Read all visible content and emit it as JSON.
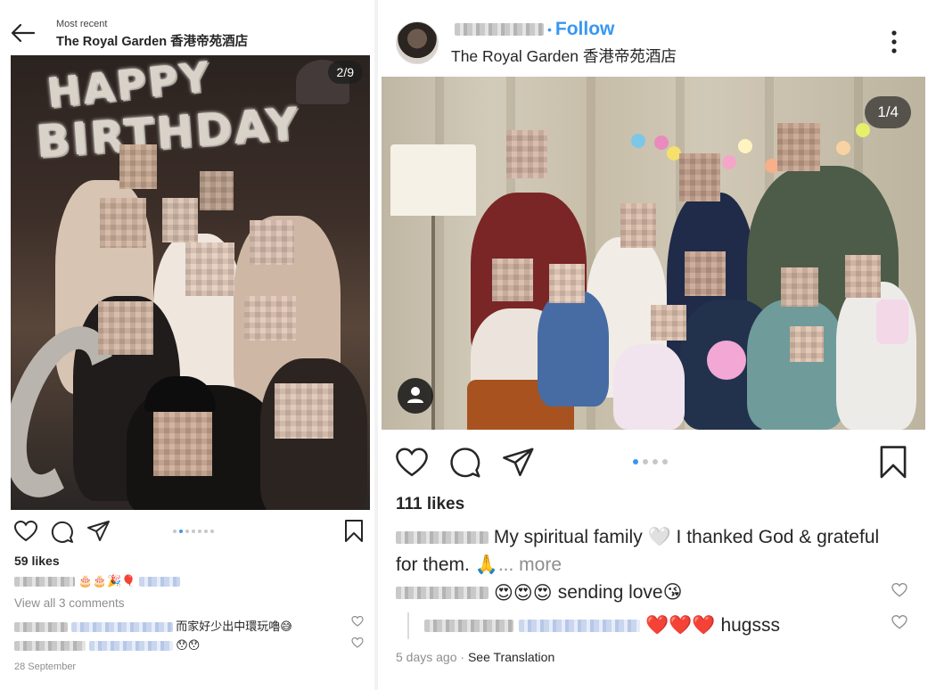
{
  "left_post": {
    "header": {
      "subtitle": "Most recent",
      "title": "The Royal Garden 香港帝苑酒店"
    },
    "photo": {
      "counter": "2/9",
      "balloon_line1": "HAPPY",
      "balloon_line2": "BIRTHDAY"
    },
    "likes": "59 likes",
    "caption_emojis": "🎂🎂🎉🎈",
    "view_all": "View all 3 comments",
    "comment1_text": "而家好少出中環玩嚕😅",
    "comment2_text": "😯😯",
    "date": "28 September"
  },
  "right_post": {
    "header": {
      "separator": "•",
      "follow": "Follow",
      "location": "The Royal Garden 香港帝苑酒店"
    },
    "photo": {
      "counter": "1/4"
    },
    "likes": "111 likes",
    "caption_text": "My spiritual family 🤍 I thanked God & grateful for them. 🙏",
    "caption_more": "... more",
    "comment1_emojis": "😍😍😍",
    "comment1_text": "sending love😘",
    "reply_emojis": "❤️❤️❤️",
    "reply_text": "hugsss",
    "time": "5 days ago",
    "separator": " · ",
    "see_translation": "See Translation"
  },
  "colors": {
    "accent": "#3897f0",
    "text": "#262626",
    "muted": "#8e8e8e",
    "heart_red": "#ed4956"
  },
  "icons": [
    "back-arrow-icon",
    "heart-icon",
    "comment-icon",
    "share-icon",
    "bookmark-icon",
    "more-icon",
    "tagged-user-icon"
  ]
}
